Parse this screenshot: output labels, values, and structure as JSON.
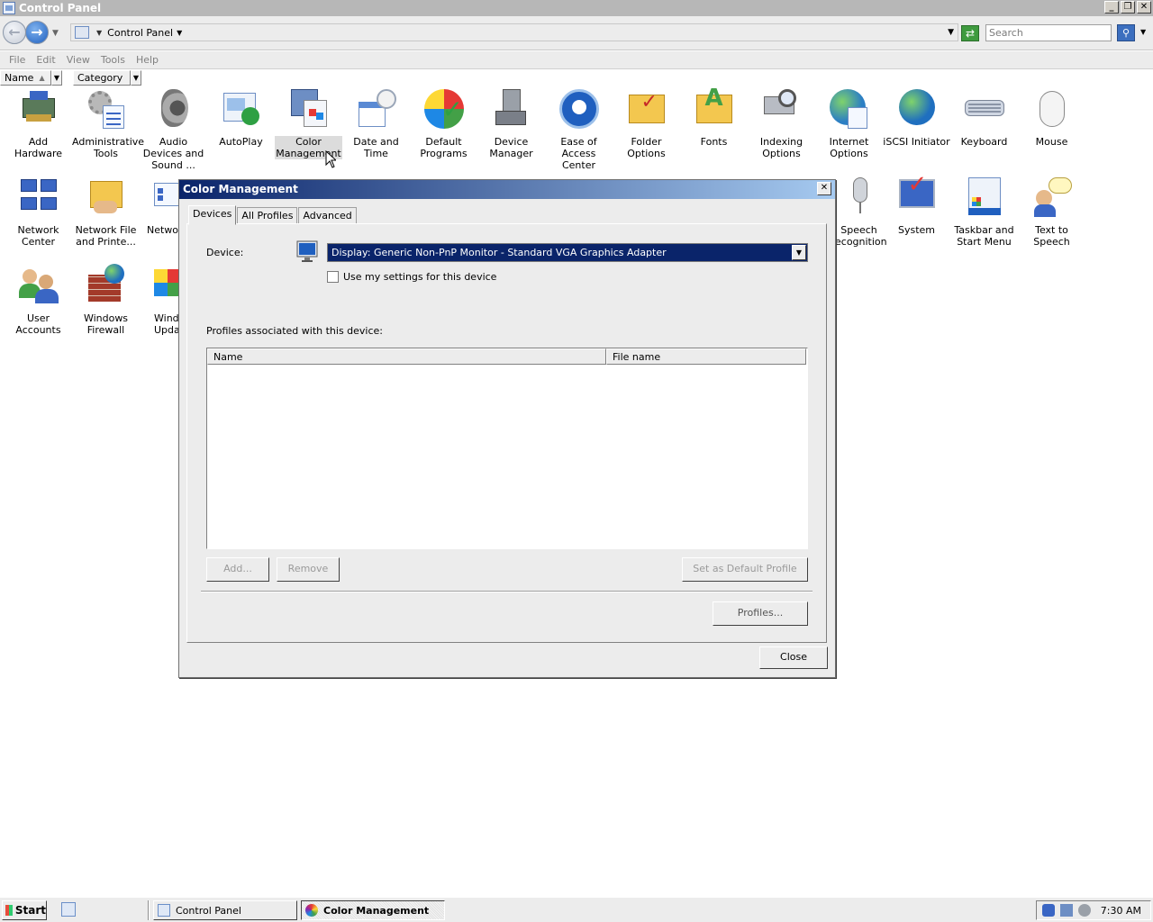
{
  "window": {
    "title": "Control Panel",
    "controls": [
      "_",
      "❐",
      "✕"
    ]
  },
  "addressbar": {
    "crumb": "Control Panel",
    "search_placeholder": "Search"
  },
  "menu": [
    "File",
    "Edit",
    "View",
    "Tools",
    "Help"
  ],
  "columns": {
    "name": "Name",
    "category": "Category"
  },
  "items": [
    {
      "label": "Add Hardware",
      "icon": "add-hardware-icon"
    },
    {
      "label": "Administrative Tools",
      "icon": "administrative-tools-icon"
    },
    {
      "label": "Audio Devices and Sound ...",
      "icon": "audio-devices-icon"
    },
    {
      "label": "AutoPlay",
      "icon": "autoplay-icon"
    },
    {
      "label": "Color Management",
      "icon": "color-management-icon"
    },
    {
      "label": "Date and Time",
      "icon": "date-time-icon"
    },
    {
      "label": "Default Programs",
      "icon": "default-programs-icon"
    },
    {
      "label": "Device Manager",
      "icon": "device-manager-icon"
    },
    {
      "label": "Ease of Access Center",
      "icon": "ease-of-access-icon"
    },
    {
      "label": "Folder Options",
      "icon": "folder-options-icon"
    },
    {
      "label": "Fonts",
      "icon": "fonts-icon"
    },
    {
      "label": "Indexing Options",
      "icon": "indexing-options-icon"
    },
    {
      "label": "Internet Options",
      "icon": "internet-options-icon"
    },
    {
      "label": "iSCSI Initiator",
      "icon": "iscsi-initiator-icon"
    },
    {
      "label": "Keyboard",
      "icon": "keyboard-icon"
    },
    {
      "label": "Mouse",
      "icon": "mouse-icon"
    },
    {
      "label": "Network Center",
      "icon": "network-center-icon"
    },
    {
      "label": "Network File and Printe...",
      "icon": "network-file-printer-icon"
    },
    {
      "label": "Networ",
      "icon": "network-icon"
    },
    {
      "label": "Speech ecognition",
      "icon": "speech-recognition-icon"
    },
    {
      "label": "System",
      "icon": "system-icon"
    },
    {
      "label": "Taskbar and Start Menu",
      "icon": "taskbar-start-menu-icon"
    },
    {
      "label": "Text to Speech",
      "icon": "text-to-speech-icon"
    },
    {
      "label": "User Accounts",
      "icon": "user-accounts-icon"
    },
    {
      "label": "Windows Firewall",
      "icon": "windows-firewall-icon"
    },
    {
      "label": "Windo Upda",
      "icon": "windows-update-icon"
    }
  ],
  "dialog": {
    "title": "Color Management",
    "close_glyph": "✕",
    "tabs": [
      "Devices",
      "All Profiles",
      "Advanced"
    ],
    "device_label": "Device:",
    "device_value": "Display: Generic Non-PnP Monitor - Standard VGA Graphics Adapter",
    "use_settings_label": "Use my settings for this device",
    "use_settings_checked": false,
    "profiles_label": "Profiles associated with this device:",
    "list_columns": [
      "Name",
      "File name"
    ],
    "buttons": {
      "add": "Add...",
      "remove": "Remove",
      "set_default": "Set as Default Profile",
      "profiles": "Profiles...",
      "close": "Close"
    }
  },
  "taskbar": {
    "start": "Start",
    "tasks": [
      "Control Panel",
      "Color Management"
    ],
    "clock": "7:30 AM"
  }
}
